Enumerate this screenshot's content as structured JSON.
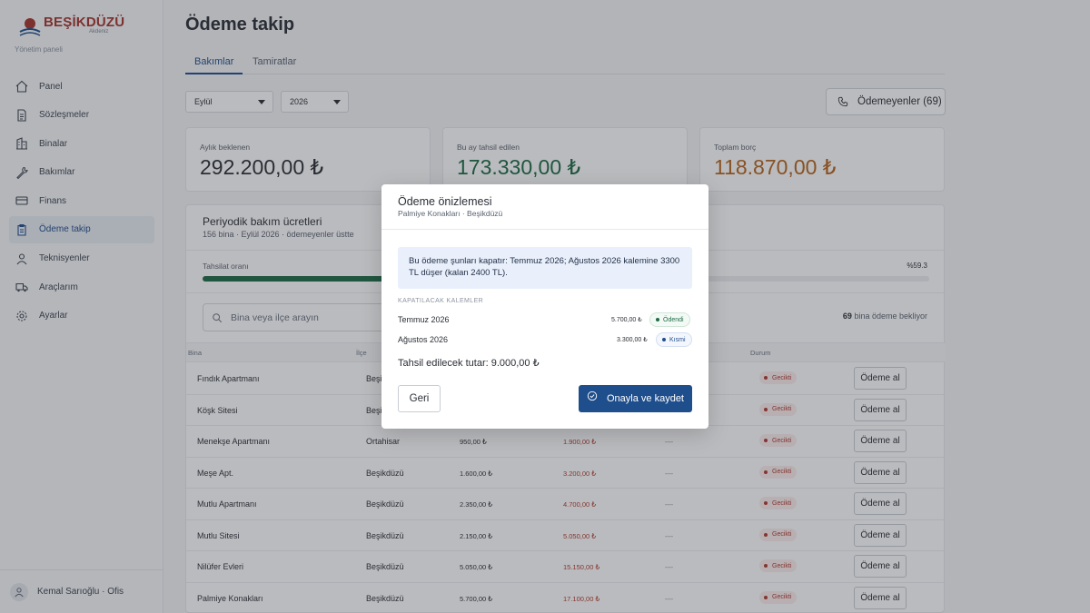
{
  "brand": {
    "name": "BEŞİKDÜZÜ",
    "subtitle": "Akdeniz",
    "caption": "Yönetim paneli"
  },
  "sidebar": {
    "items": [
      {
        "label": "Panel",
        "icon": "home-icon"
      },
      {
        "label": "Sözleşmeler",
        "icon": "document-icon"
      },
      {
        "label": "Binalar",
        "icon": "building-icon"
      },
      {
        "label": "Bakımlar",
        "icon": "wrench-icon"
      },
      {
        "label": "Finans",
        "icon": "card-icon"
      },
      {
        "label": "Ödeme takip",
        "icon": "clipboard-icon",
        "active": true
      },
      {
        "label": "Teknisyenler",
        "icon": "person-icon"
      },
      {
        "label": "Araçlarım",
        "icon": "truck-icon"
      },
      {
        "label": "Ayarlar",
        "icon": "gear-icon"
      }
    ],
    "user": {
      "name": "Kemal Sarıoğlu · Ofis"
    }
  },
  "header": {
    "title": "Ödeme takip"
  },
  "tabs": [
    {
      "label": "Bakımlar",
      "active": true
    },
    {
      "label": "Tamiratlar"
    }
  ],
  "filters": {
    "month": "Eylül",
    "year": "2026"
  },
  "unpaid_button": {
    "label": "Ödemeyenler (69)"
  },
  "kpis": [
    {
      "label": "Aylık beklenen",
      "value": "292.200,00 ₺",
      "color": "#2b2f36"
    },
    {
      "label": "Bu ay tahsil edilen",
      "value": "173.330,00 ₺",
      "color": "#1d6b45"
    },
    {
      "label": "Toplam borç",
      "value": "118.870,00 ₺",
      "color": "#b5651d"
    }
  ],
  "section": {
    "title": "Periyodik bakım ücretleri",
    "subtitle": "156 bina · Eylül 2026 · ödemeyenler üstte",
    "rate_label": "Tahsilat oranı",
    "rate_pct_text": "%59.3",
    "rate_value": 0.593,
    "search_placeholder": "Bina veya ilçe arayın",
    "waiting_count": "69",
    "waiting_text": "bina ödeme bekliyor",
    "columns": {
      "bina": "Bina",
      "ilce": "İlçe",
      "durum": "Durum"
    },
    "rows": [
      {
        "bina": "Fındık Apartmanı",
        "ilce": "Beşikdüzü",
        "aylik": "",
        "borc": "",
        "son": "—",
        "durum": "Gecikti",
        "action": "Ödeme al"
      },
      {
        "bina": "Köşk Sitesi",
        "ilce": "Beşikdüzü",
        "aylik": "",
        "borc": "",
        "son": "—",
        "durum": "Gecikti",
        "action": "Ödeme al"
      },
      {
        "bina": "Menekşe Apartmanı",
        "ilce": "Ortahisar",
        "aylik": "950,00 ₺",
        "borc": "1.900,00 ₺",
        "son": "—",
        "durum": "Gecikti",
        "action": "Ödeme al"
      },
      {
        "bina": "Meşe Apt.",
        "ilce": "Beşikdüzü",
        "aylik": "1.600,00 ₺",
        "borc": "3.200,00 ₺",
        "son": "—",
        "durum": "Gecikti",
        "action": "Ödeme al"
      },
      {
        "bina": "Mutlu Apartmanı",
        "ilce": "Beşikdüzü",
        "aylik": "2.350,00 ₺",
        "borc": "4.700,00 ₺",
        "son": "—",
        "durum": "Gecikti",
        "action": "Ödeme al"
      },
      {
        "bina": "Mutlu Sitesi",
        "ilce": "Beşikdüzü",
        "aylik": "2.150,00 ₺",
        "borc": "5.050,00 ₺",
        "son": "—",
        "durum": "Gecikti",
        "action": "Ödeme al"
      },
      {
        "bina": "Nilüfer Evleri",
        "ilce": "Beşikdüzü",
        "aylik": "5.050,00 ₺",
        "borc": "15.150,00 ₺",
        "son": "—",
        "durum": "Gecikti",
        "action": "Ödeme al"
      },
      {
        "bina": "Palmiye Konakları",
        "ilce": "Beşikdüzü",
        "aylik": "5.700,00 ₺",
        "borc": "17.100,00 ₺",
        "son": "—",
        "durum": "Gecikti",
        "action": "Ödeme al"
      }
    ]
  },
  "modal": {
    "title": "Ödeme önizlemesi",
    "subtitle": "Palmiye Konakları · Beşikdüzü",
    "info": "Bu ödeme şunları kapatır: Temmuz 2026; Ağustos 2026 kalemine 3300 TL düşer (kalan 2400 TL).",
    "section_label": "KAPATILACAK KALEMLER",
    "items": [
      {
        "name": "Temmuz 2026",
        "amount": "5.700,00 ₺",
        "status": "Ödendi"
      },
      {
        "name": "Ağustos 2026",
        "amount": "3.300,00 ₺",
        "status": "Kısmi"
      }
    ],
    "total": "Tahsil edilecek tutar: 9.000,00 ₺",
    "back_label": "Geri",
    "confirm_label": "Onayla ve kaydet"
  }
}
